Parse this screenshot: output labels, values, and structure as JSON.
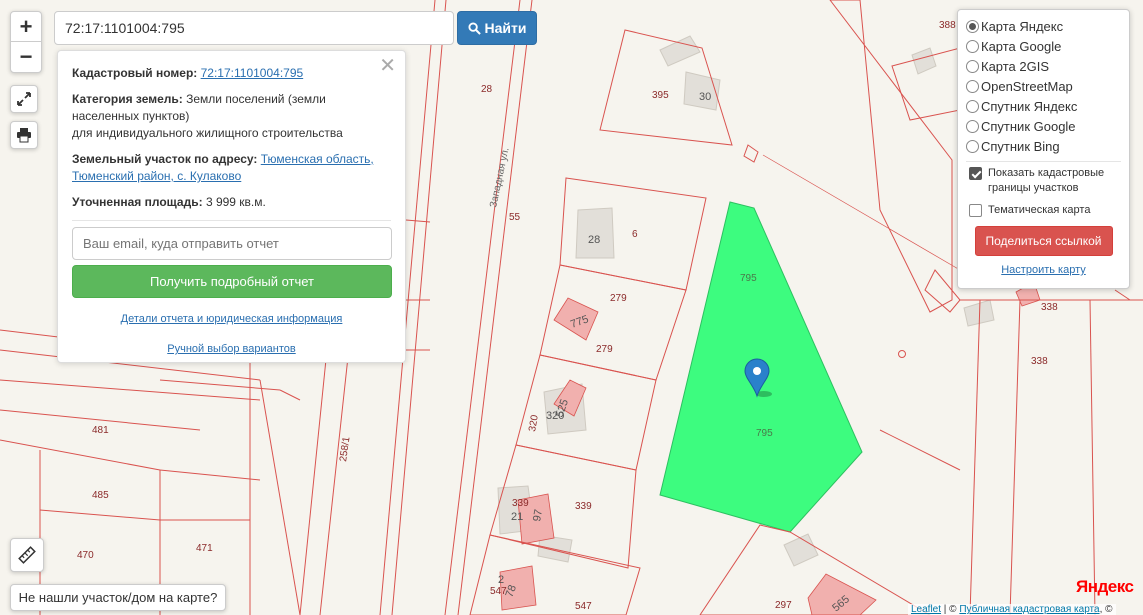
{
  "search": {
    "value": "72:17:1101004:795",
    "button_label": "Найти"
  },
  "info": {
    "cadastral_label": "Кадастровый номер:",
    "cadastral_number": "72:17:1101004:795",
    "category_label": "Категория земель:",
    "category_value": "Земли поселений (земли населенных пунктов)",
    "category_use": "для индивидуального жилищного строительства",
    "address_label": "Земельный участок по адресу:",
    "address_value": "Тюменская область, Тюменский район, с. Кулаково",
    "area_label": "Уточненная площадь:",
    "area_value": "3 999 кв.м.",
    "email_placeholder": "Ваш email, куда отправить отчет",
    "report_button": "Получить подробный отчет",
    "details_link": "Детали отчета и юридическая информация",
    "manual_link": "Ручной выбор вариантов"
  },
  "layers": {
    "options": [
      {
        "label": "Карта Яндекс",
        "selected": true
      },
      {
        "label": "Карта Google",
        "selected": false
      },
      {
        "label": "Карта 2GIS",
        "selected": false
      },
      {
        "label": "OpenStreetMap",
        "selected": false
      },
      {
        "label": "Спутник Яндекс",
        "selected": false
      },
      {
        "label": "Спутник Google",
        "selected": false
      },
      {
        "label": "Спутник Bing",
        "selected": false
      }
    ],
    "show_borders_label": "Показать кадастровые границы участков",
    "show_borders": true,
    "thematic_label": "Тематическая карта",
    "thematic": false,
    "share_button": "Поделиться ссылкой",
    "setup_link": "Настроить карту"
  },
  "map": {
    "street_name": "Западная ул.",
    "parcel_labels": [
      "388",
      "395",
      "28",
      "55",
      "6",
      "279",
      "279",
      "795",
      "795",
      "320",
      "338",
      "338",
      "481",
      "485",
      "470",
      "471",
      "258/1",
      "339",
      "339",
      "547",
      "547",
      "297"
    ],
    "house_numbers": [
      "30",
      "28",
      "775",
      "525",
      "320",
      "21",
      "97",
      "2",
      "78",
      "565"
    ],
    "selected_parcel_color": "#3dfc7f",
    "border_color": "#d9534f"
  },
  "controls": {
    "zoom_in": "+",
    "zoom_out": "−",
    "not_found_label": "Не нашли участок/дом на карте?"
  },
  "branding": {
    "yandex_logo": "Яндекс",
    "attribution_leaflet": "Leaflet",
    "attribution_sep": " | © ",
    "attribution_pkk": "Публичная кадастровая карта",
    "attribution_end": ", ©"
  }
}
